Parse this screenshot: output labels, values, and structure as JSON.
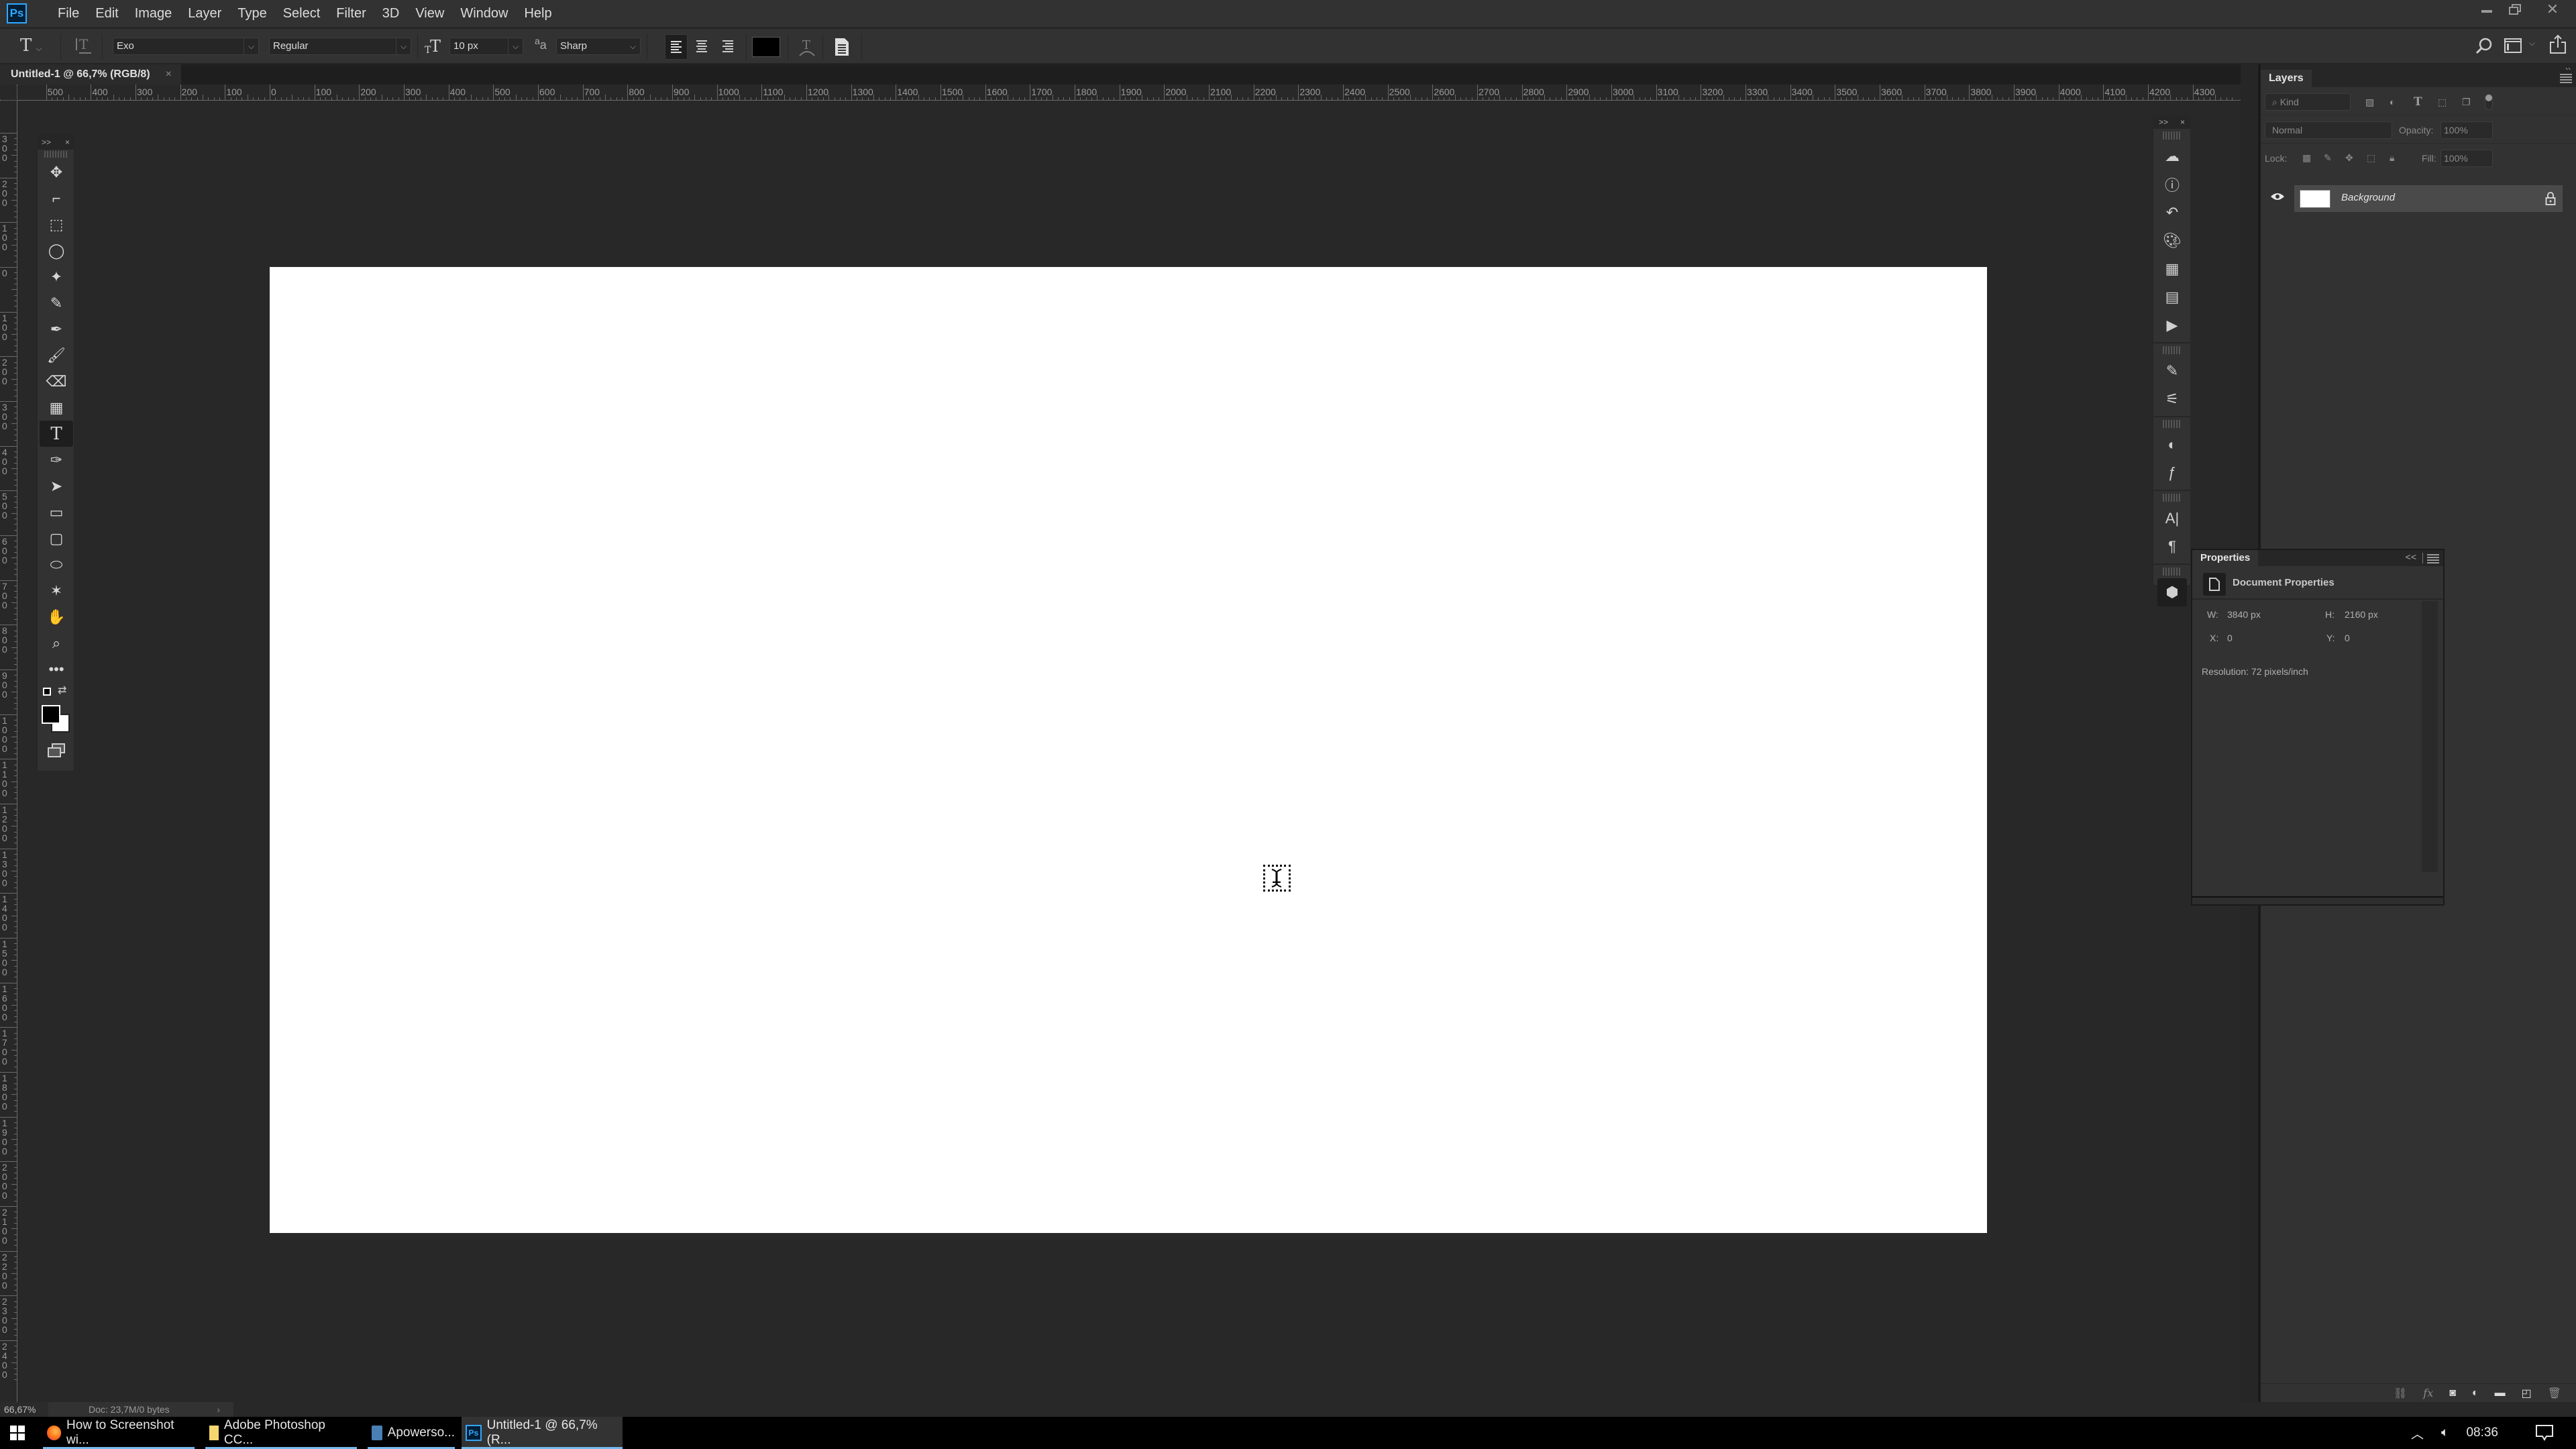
{
  "app": {
    "logo": "Ps",
    "name": "Adobe Photoshop"
  },
  "menubar": {
    "items": [
      "File",
      "Edit",
      "Image",
      "Layer",
      "Type",
      "Select",
      "Filter",
      "3D",
      "View",
      "Window",
      "Help"
    ],
    "window_controls": {
      "minimize": "minimize-icon",
      "restore": "restore-icon",
      "close": "close-icon"
    }
  },
  "options_bar": {
    "tool_preset": "T",
    "font_family": "Exo",
    "font_style": "Regular",
    "font_size": "10 px",
    "anti_alias": "Sharp",
    "align": [
      "align-left",
      "align-center",
      "align-right"
    ],
    "active_align": "align-left",
    "text_color": "#000000",
    "right_icons": [
      "search-icon",
      "workspace-icon",
      "share-icon"
    ]
  },
  "document": {
    "tab_title": "Untitled-1 @ 66,7% (RGB/8)",
    "close_glyph": "×",
    "canvas_color": "#ffffff",
    "zoom": "66,67%",
    "doc_info": "Doc: 23,7M/0 bytes",
    "doc_info_arrow": "›"
  },
  "rulers": {
    "horizontal_labels": [
      "500",
      "400",
      "300",
      "200",
      "100",
      "0",
      "100",
      "200",
      "300",
      "400",
      "500",
      "600",
      "700",
      "800",
      "900",
      "1000",
      "1100",
      "1200",
      "1300",
      "1400",
      "1500",
      "1600",
      "1700",
      "1800",
      "1900",
      "2000",
      "2100",
      "2200",
      "2300",
      "2400",
      "2500",
      "2600",
      "2700",
      "2800",
      "2900",
      "3000",
      "3100",
      "3200",
      "3300",
      "3400",
      "3500",
      "3600",
      "3700",
      "3800",
      "3900",
      "4000",
      "4100",
      "4200",
      "4300"
    ],
    "vertical_labels": [
      "300",
      "200",
      "100",
      "0",
      "100",
      "200",
      "300",
      "400",
      "500",
      "600",
      "700",
      "800",
      "900",
      "1000",
      "1100",
      "1200",
      "1300",
      "1400",
      "1500",
      "1600",
      "1700",
      "1800",
      "1900",
      "2000",
      "2100",
      "2200",
      "2300",
      "2400"
    ]
  },
  "toolbox": {
    "header": {
      "expand": ">>",
      "close": "×"
    },
    "tools": [
      {
        "name": "move-tool",
        "glyph": "✥"
      },
      {
        "name": "artboard-tool",
        "glyph": "⌐"
      },
      {
        "name": "rectangular-marquee-tool",
        "glyph": "⬚"
      },
      {
        "name": "lasso-tool",
        "glyph": "◯"
      },
      {
        "name": "magic-wand-tool",
        "glyph": "✦"
      },
      {
        "name": "quick-selection-tool",
        "glyph": "✎"
      },
      {
        "name": "eyedropper-tool",
        "glyph": "✒"
      },
      {
        "name": "brush-tool",
        "glyph": "🖌"
      },
      {
        "name": "eraser-tool",
        "glyph": "⌫"
      },
      {
        "name": "gradient-tool",
        "glyph": "▦"
      },
      {
        "name": "type-tool",
        "glyph": "T"
      },
      {
        "name": "pen-tool",
        "glyph": "✑"
      },
      {
        "name": "path-selection-tool",
        "glyph": "➤"
      },
      {
        "name": "rectangle-tool",
        "glyph": "▭"
      },
      {
        "name": "rounded-rectangle-tool",
        "glyph": "▢"
      },
      {
        "name": "ellipse-tool",
        "glyph": "⬭"
      },
      {
        "name": "custom-shape-tool",
        "glyph": "✶"
      },
      {
        "name": "hand-tool",
        "glyph": "✋"
      },
      {
        "name": "zoom-tool",
        "glyph": "⌕"
      },
      {
        "name": "more-tools",
        "glyph": "•••"
      }
    ],
    "active_tool": "type-tool",
    "foreground_color": "#000000",
    "background_color": "#ffffff"
  },
  "icon_strip": {
    "header": {
      "expand": ">>",
      "close": "×"
    },
    "groups": [
      [
        "libraries-icon",
        "info-icon",
        "history-icon",
        "color-icon",
        "swatches-icon",
        "properties-icon",
        "actions-icon"
      ],
      [
        "brush-presets-icon",
        "brush-settings-icon"
      ],
      [
        "adjustments-icon",
        "styles-icon"
      ],
      [
        "character-icon",
        "paragraph-icon"
      ],
      [
        "3d-icon"
      ]
    ]
  },
  "layers_panel": {
    "title": "Layers",
    "filter_kind": "Kind",
    "blend_mode": "Normal",
    "opacity_label": "Opacity:",
    "opacity": "100%",
    "lock_label": "Lock:",
    "fill_label": "Fill:",
    "fill": "100%",
    "layers": [
      {
        "name": "Background",
        "visible": true,
        "locked": true
      }
    ],
    "footer_icons": [
      "link-layers-icon",
      "fx-icon",
      "add-mask-icon",
      "adjustment-layer-icon",
      "new-group-icon",
      "new-layer-icon",
      "delete-layer-icon"
    ]
  },
  "properties_panel": {
    "title": "Properties",
    "section": "Document Properties",
    "w_label": "W:",
    "w_value": "3840 px",
    "h_label": "H:",
    "h_value": "2160 px",
    "x_label": "X:",
    "x_value": "0",
    "y_label": "Y:",
    "y_value": "0",
    "resolution": "Resolution: 72 pixels/inch",
    "collapse": "<<"
  },
  "taskbar": {
    "items": [
      {
        "label": "How to Screenshot wi...",
        "icon": "firefox-icon",
        "active": false
      },
      {
        "label": "Adobe Photoshop CC...",
        "icon": "folder-icon",
        "active": false
      },
      {
        "label": "Apowerso...",
        "icon": "apowersoft-icon",
        "active": false
      },
      {
        "label": "Untitled-1 @ 66,7% (R...",
        "icon": "photoshop-icon",
        "active": true
      }
    ],
    "clock": "08:36"
  }
}
